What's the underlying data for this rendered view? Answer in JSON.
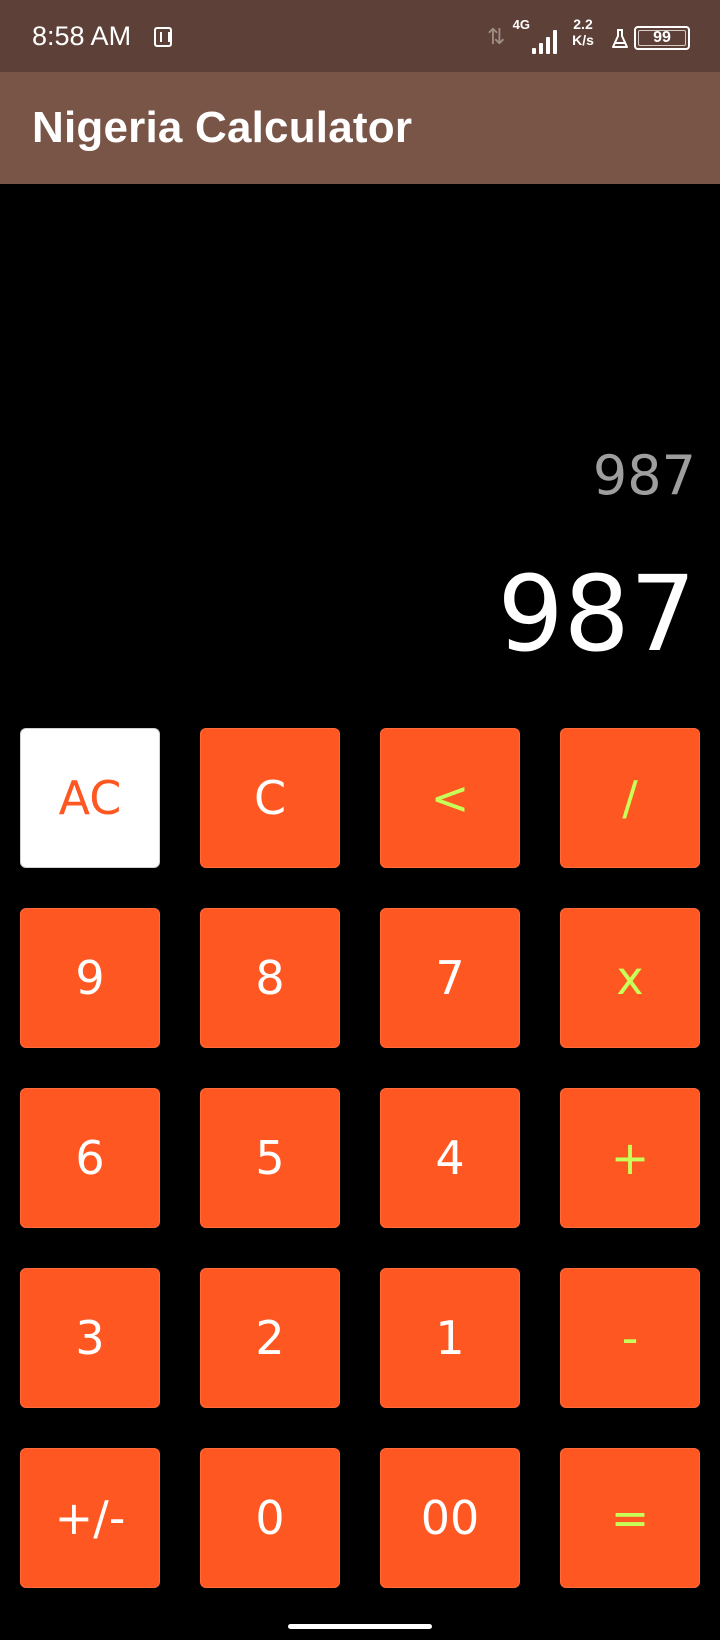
{
  "status_bar": {
    "time": "8:58 AM",
    "network_type": "4G",
    "speed_value": "2.2",
    "speed_unit": "K/s",
    "battery": "99",
    "icons": [
      "app-notification-icon",
      "data-arrows-icon",
      "signal-icon",
      "flask-icon",
      "battery-icon"
    ]
  },
  "app_bar": {
    "title": "Nigeria Calculator"
  },
  "display": {
    "expression": "987",
    "result": "987"
  },
  "keypad": {
    "rows": [
      [
        "AC",
        "C",
        "<",
        "/"
      ],
      [
        "9",
        "8",
        "7",
        "x"
      ],
      [
        "6",
        "5",
        "4",
        "+"
      ],
      [
        "3",
        "2",
        "1",
        "-"
      ],
      [
        "+/-",
        "0",
        "00",
        "="
      ]
    ]
  },
  "colors": {
    "status_bar": "#5d4037",
    "app_bar": "#795548",
    "key_background": "#ff5722",
    "operator_text": "#c6ff5a",
    "ac_background": "#ffffff"
  }
}
